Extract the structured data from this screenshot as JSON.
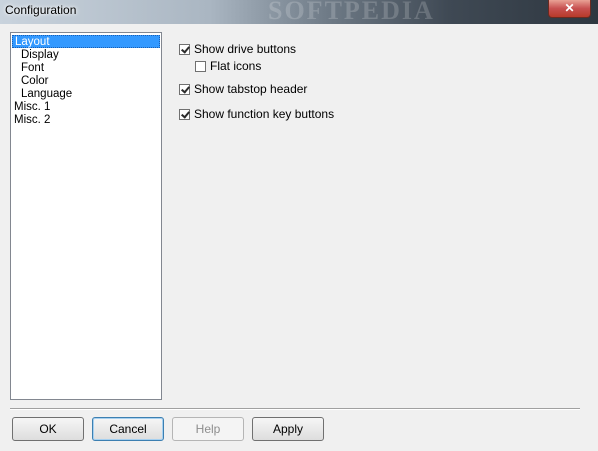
{
  "window": {
    "title": "Configuration",
    "watermark": "SOFTPEDIA",
    "close_glyph": "✕"
  },
  "sidebar": {
    "items": [
      {
        "label": "Layout",
        "selected": true
      },
      {
        "label": "Display"
      },
      {
        "label": "Font"
      },
      {
        "label": "Color"
      },
      {
        "label": "Language"
      },
      {
        "label": "Misc. 1"
      },
      {
        "label": "Misc. 2"
      }
    ]
  },
  "options": {
    "show_drive_buttons": {
      "label": "Show drive buttons",
      "checked": true
    },
    "flat_icons": {
      "label": "Flat icons",
      "checked": false
    },
    "show_tabstop_header": {
      "label": "Show tabstop header",
      "checked": true
    },
    "show_function_key_buttons": {
      "label": "Show function key buttons",
      "checked": true
    }
  },
  "buttons": {
    "ok": "OK",
    "cancel": "Cancel",
    "help": "Help",
    "apply": "Apply"
  },
  "colors": {
    "selection": "#3399ff",
    "dialog_bg": "#f0f0f0",
    "close_button": "#c75050"
  }
}
